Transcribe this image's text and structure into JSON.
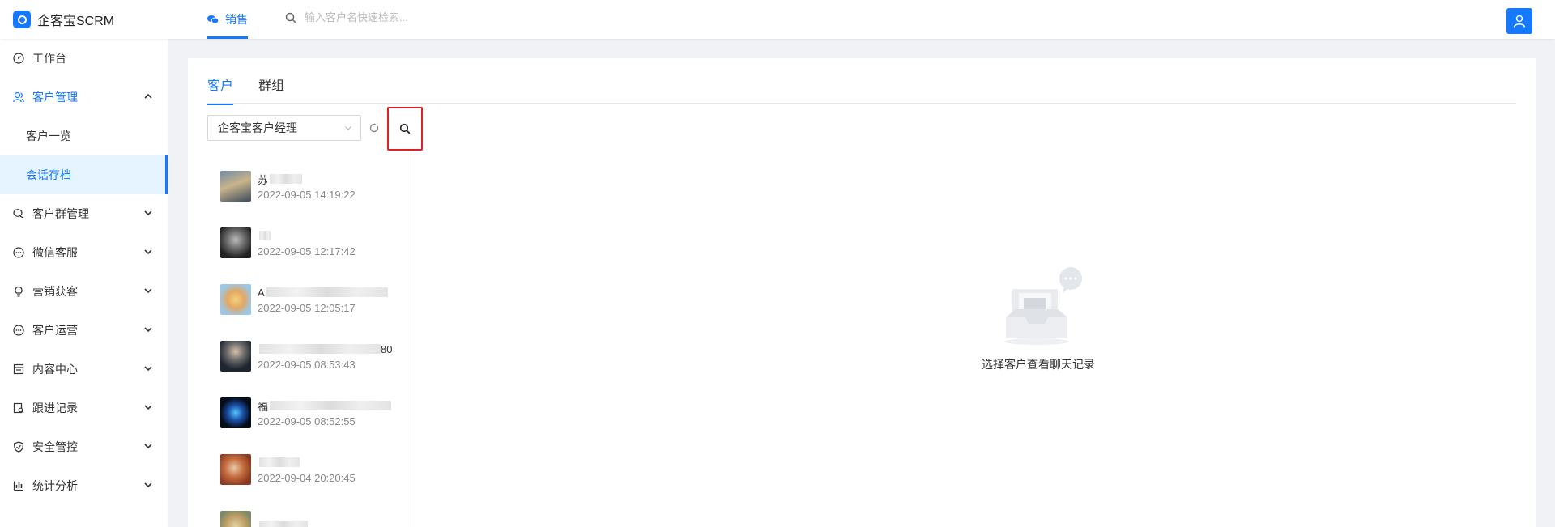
{
  "app": {
    "title": "企客宝SCRM"
  },
  "topnav": {
    "active_tab": "销售",
    "search_placeholder": "输入客户名快速检索..."
  },
  "sidebar": {
    "items": [
      {
        "label": "工作台"
      },
      {
        "label": "客户管理"
      },
      {
        "label": "客户一览"
      },
      {
        "label": "会话存档"
      },
      {
        "label": "客户群管理"
      },
      {
        "label": "微信客服"
      },
      {
        "label": "营销获客"
      },
      {
        "label": "客户运营"
      },
      {
        "label": "内容中心"
      },
      {
        "label": "跟进记录"
      },
      {
        "label": "安全管控"
      },
      {
        "label": "统计分析"
      }
    ]
  },
  "main": {
    "tabs": [
      {
        "label": "客户"
      },
      {
        "label": "群组"
      }
    ],
    "manager_select": "企客宝客户经理",
    "chats": [
      {
        "name": "苏",
        "time": "2022-09-05 14:19:22"
      },
      {
        "name": "",
        "time": "2022-09-05 12:17:42"
      },
      {
        "name": "A",
        "time": "2022-09-05 12:05:17"
      },
      {
        "name": "80",
        "time": "2022-09-05 08:53:43"
      },
      {
        "name": "福",
        "time": "2022-09-05 08:52:55"
      },
      {
        "name": "",
        "time": "2022-09-04 20:20:45"
      },
      {
        "name": "",
        "time": ""
      }
    ],
    "empty_text": "选择客户查看聊天记录"
  },
  "colors": {
    "accent": "#1677ff",
    "highlight_border": "#e02020"
  }
}
